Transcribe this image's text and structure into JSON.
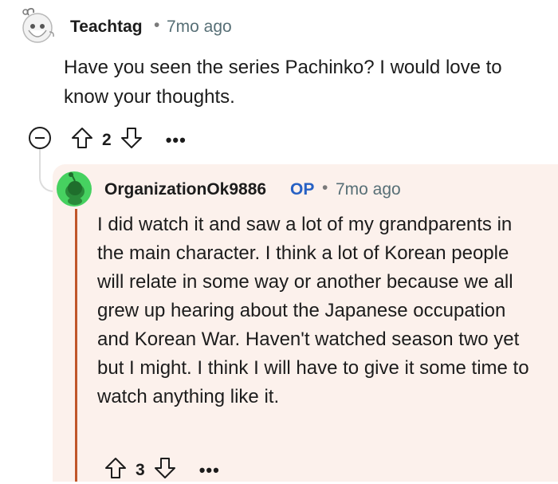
{
  "comment": {
    "username": "Teachtag",
    "separator": "•",
    "time_ago": "7mo ago",
    "text": "Have you seen the series Pachinko? I would love to know your thoughts.",
    "score": "2",
    "more_label": "•••"
  },
  "reply": {
    "username": "OrganizationOk9886",
    "op_badge": "OP",
    "separator": "•",
    "time_ago": "7mo ago",
    "text": "I did watch it and saw a lot of my grandparents in the main character. I think a lot of Korean people will relate in some way or another because we all grew up hearing about the Japanese occupation and Korean War. Haven't watched season two yet but I might. I think I will have to give it some time to watch anything like it.",
    "score": "3",
    "more_label": "•••",
    "highlight_color": "#fcf1ec",
    "accent_bar_color": "#c0562a"
  },
  "colors": {
    "op_badge": "#2761c4",
    "timestamp": "#576f76"
  }
}
